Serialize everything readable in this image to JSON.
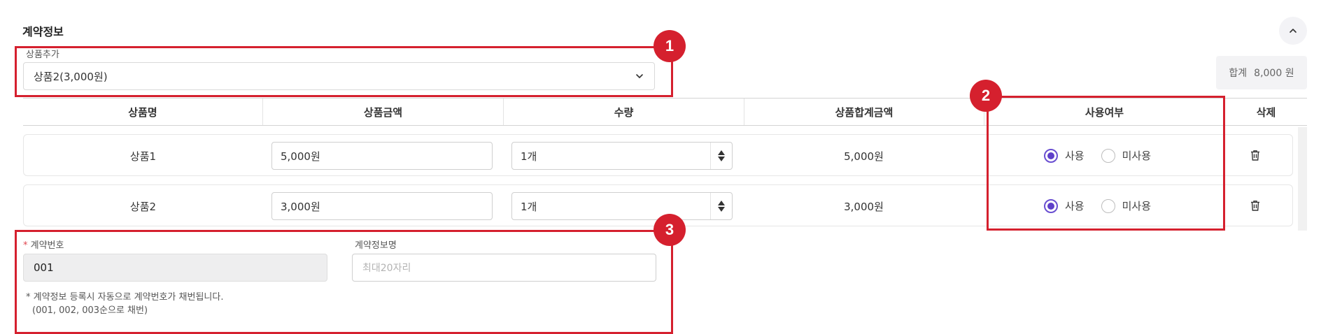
{
  "section": {
    "title": "계약정보",
    "collapse_icon": "chevron-up-icon"
  },
  "product_add": {
    "label": "상품추가",
    "selected": "상품2(3,000원)"
  },
  "total": {
    "label": "합계",
    "value": "8,000 원"
  },
  "table": {
    "headers": [
      "상품명",
      "상품금액",
      "수량",
      "상품합계금액",
      "사용여부",
      "삭제"
    ],
    "rows": [
      {
        "name": "상품1",
        "price": "5,000원",
        "qty": "1개",
        "subtotal": "5,000원",
        "use_label": "사용",
        "unuse_label": "미사용",
        "status": "사용"
      },
      {
        "name": "상품2",
        "price": "3,000원",
        "qty": "1개",
        "subtotal": "3,000원",
        "use_label": "사용",
        "unuse_label": "미사용",
        "status": "사용"
      }
    ]
  },
  "contract_number": {
    "required_mark": "*",
    "label": "계약번호",
    "value": "001"
  },
  "contract_info_name": {
    "label": "계약정보명",
    "placeholder": "최대20자리"
  },
  "note": {
    "line1": "* 계약정보 등록시 자동으로 계약번호가 채번됩니다.",
    "line2": "(001, 002, 003순으로 채번)"
  },
  "annotations": [
    {
      "number": "1"
    },
    {
      "number": "2"
    },
    {
      "number": "3"
    }
  ],
  "colors": {
    "highlight": "#d5202e",
    "radio_accent": "#5e3fc9"
  }
}
